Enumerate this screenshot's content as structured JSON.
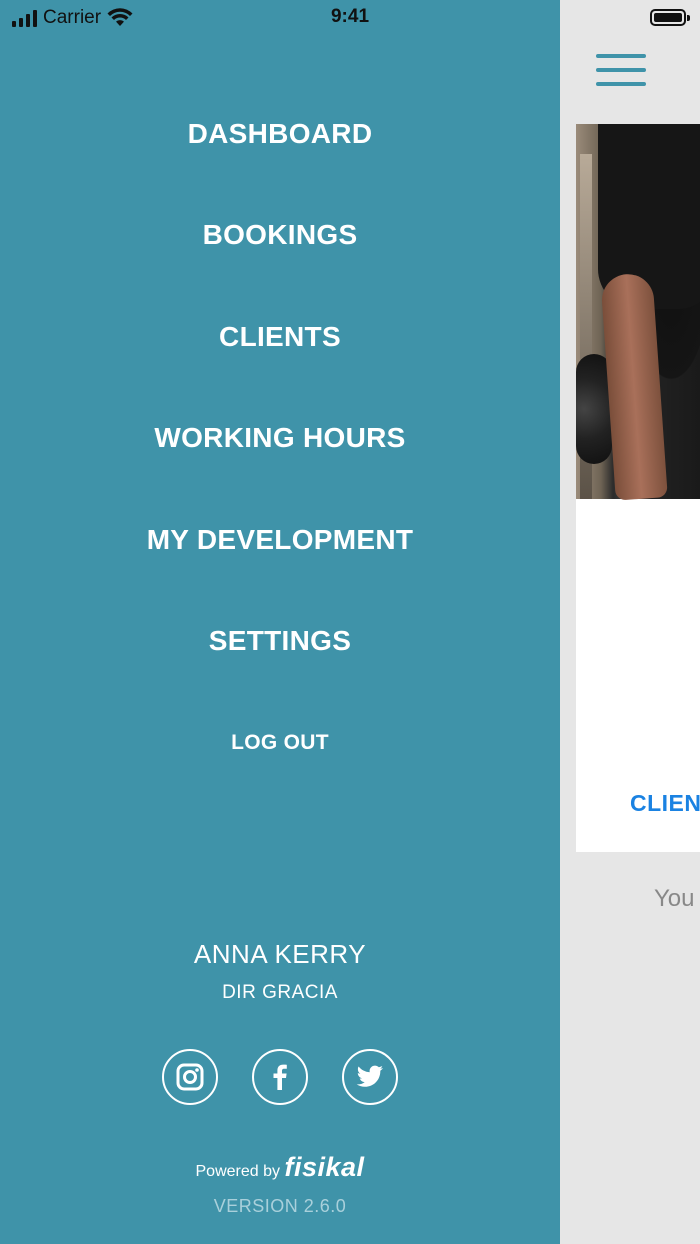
{
  "status_bar": {
    "carrier": "Carrier",
    "time": "9:41"
  },
  "menu": {
    "items": [
      "DASHBOARD",
      "BOOKINGS",
      "CLIENTS",
      "WORKING HOURS",
      "MY DEVELOPMENT",
      "SETTINGS"
    ],
    "logout": "LOG OUT"
  },
  "profile": {
    "name": "ANNA KERRY",
    "role": "DIR GRACIA"
  },
  "socials": [
    "instagram-icon",
    "facebook-icon",
    "twitter-icon"
  ],
  "footer": {
    "powered_by": "Powered by",
    "brand": "fisikal",
    "version": "VERSION 2.6.0"
  },
  "background_content": {
    "client_link": "CLIEN",
    "note": "You"
  },
  "colors": {
    "drawer": "#3f93a9",
    "background": "#e6e6e6",
    "link": "#1a82e2"
  }
}
